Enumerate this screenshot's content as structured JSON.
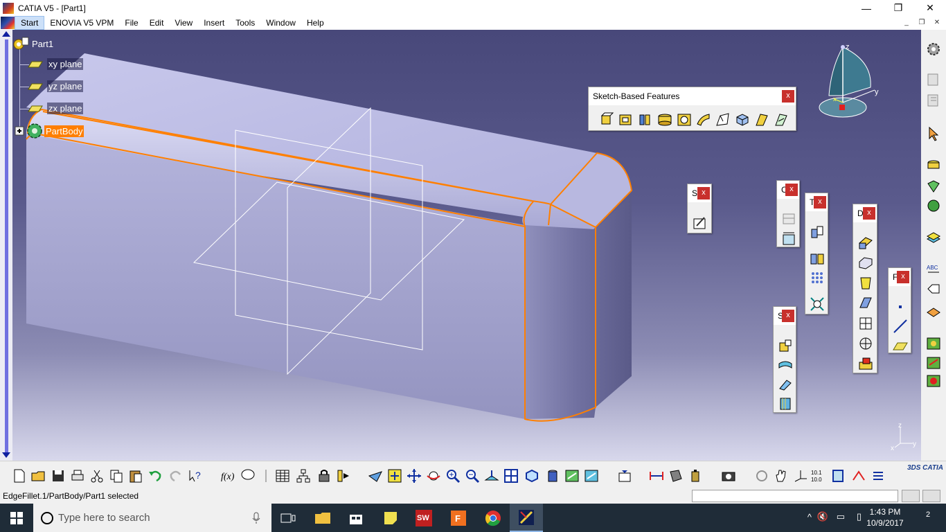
{
  "window": {
    "title": "CATIA V5 - [Part1]",
    "minimize": "—",
    "maximize": "❐",
    "close": "✕"
  },
  "menubar": {
    "items": [
      "Start",
      "ENOVIA V5 VPM",
      "File",
      "Edit",
      "View",
      "Insert",
      "Tools",
      "Window",
      "Help"
    ],
    "active": "Start"
  },
  "tree": {
    "root": "Part1",
    "planes": [
      "xy plane",
      "yz plane",
      "zx plane"
    ],
    "body": "PartBody",
    "selected": "PartBody"
  },
  "compass": {
    "axis_z": "z",
    "axis_x": "x",
    "axis_y": "y"
  },
  "axis_triad": {
    "z": "z",
    "x": "x",
    "y": "y"
  },
  "toolbars": {
    "sketch_based": {
      "title": "Sketch-Based Features",
      "close": "x"
    },
    "sketcher": {
      "title": "S",
      "close": "x"
    },
    "constraint": {
      "title": "C",
      "close": "x"
    },
    "transform": {
      "title": "T",
      "close": "x"
    },
    "dress_up": {
      "title": "D",
      "close": "x"
    },
    "surface": {
      "title": "S",
      "close": "x"
    },
    "reference": {
      "title": "F",
      "close": "x"
    }
  },
  "statusbar": {
    "message": "EdgeFillet.1/PartBody/Part1 selected",
    "command_value": ""
  },
  "taskbar": {
    "search_placeholder": "Type here to search",
    "time": "1:43 PM",
    "date": "10/9/2017",
    "notifications": "2"
  },
  "colors": {
    "selection": "#ff7f00",
    "viewport_top": "#48487a",
    "part_face": "#b8b8e0"
  }
}
